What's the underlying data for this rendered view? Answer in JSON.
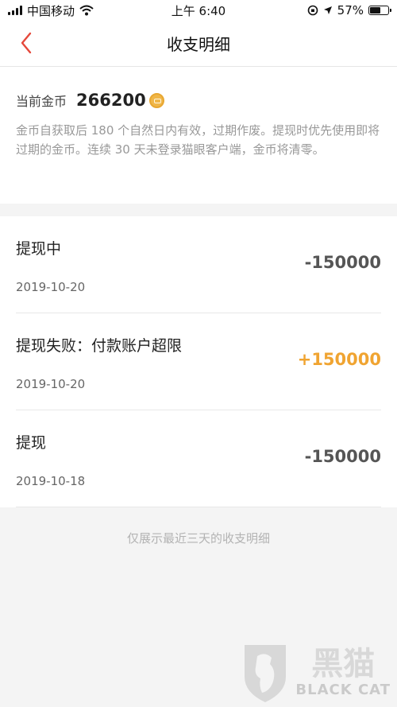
{
  "status_bar": {
    "carrier": "中国移动",
    "time": "上午 6:40",
    "battery": "57%",
    "battery_level": 0.57
  },
  "header": {
    "title": "收支明细"
  },
  "coins": {
    "label": "当前金币",
    "value": "266200",
    "description": "金币自获取后 180 个自然日内有效，过期作废。提现时优先使用即将过期的金币。连续 30 天未登录猫眼客户端，金币将清零。"
  },
  "records": [
    {
      "title": "提现中",
      "date": "2019-10-20",
      "amount": "-150000",
      "positive": false
    },
    {
      "title": "提现失败：付款账户超限",
      "date": "2019-10-20",
      "amount": "+150000",
      "positive": true
    },
    {
      "title": "提现",
      "date": "2019-10-18",
      "amount": "-150000",
      "positive": false
    }
  ],
  "footer": {
    "note": "仅展示最近三天的收支明细"
  },
  "watermark": {
    "cn": "黑猫",
    "en": "BLACK CAT"
  },
  "colors": {
    "accent_back": "#e5483b",
    "positive_amount": "#f0a431",
    "negative_amount": "#555555"
  }
}
